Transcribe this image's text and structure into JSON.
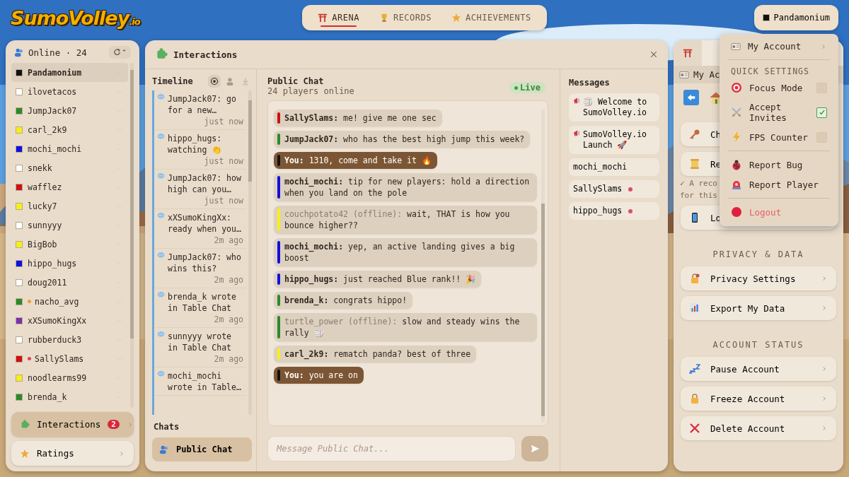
{
  "logo": {
    "name": "SumoVolley",
    "suffix": ".io"
  },
  "nav": [
    {
      "label": "ARENA",
      "selected": true
    },
    {
      "label": "RECORDS",
      "selected": false
    },
    {
      "label": "ACHIEVEMENTS",
      "selected": false
    }
  ],
  "user_button": {
    "label": "Pandamonium",
    "color": "#111111"
  },
  "online": {
    "title": "Online · 24"
  },
  "players": [
    {
      "name": "Pandamonium",
      "color": "#111111",
      "away": false,
      "busy": false,
      "selected": true
    },
    {
      "name": "ilovetacos",
      "color": "#ffffff",
      "away": false,
      "busy": false,
      "selected": false
    },
    {
      "name": "JumpJack07",
      "color": "#2a8a2a",
      "away": false,
      "busy": false,
      "selected": false
    },
    {
      "name": "carl_2k9",
      "color": "#f5f01a",
      "away": false,
      "busy": false,
      "selected": false
    },
    {
      "name": "mochi_mochi",
      "color": "#1010e0",
      "away": false,
      "busy": false,
      "selected": false
    },
    {
      "name": "snekk",
      "color": "#ffffff",
      "away": false,
      "busy": false,
      "selected": false
    },
    {
      "name": "wafflez",
      "color": "#cc1111",
      "away": false,
      "busy": false,
      "selected": false
    },
    {
      "name": "lucky7",
      "color": "#f5f01a",
      "away": false,
      "busy": false,
      "selected": false
    },
    {
      "name": "sunnyyy",
      "color": "#ffffff",
      "away": false,
      "busy": false,
      "selected": false
    },
    {
      "name": "BigBob",
      "color": "#f5f01a",
      "away": false,
      "busy": false,
      "selected": false
    },
    {
      "name": "hippo_hugs",
      "color": "#1010e0",
      "away": false,
      "busy": false,
      "selected": false
    },
    {
      "name": "doug2011",
      "color": "#ffffff",
      "away": false,
      "busy": false,
      "selected": false
    },
    {
      "name": "nacho_avg",
      "color": "#2a8a2a",
      "away": true,
      "busy": false,
      "selected": false
    },
    {
      "name": "xXSumoKingXx",
      "color": "#7a30b0",
      "away": false,
      "busy": false,
      "selected": false
    },
    {
      "name": "rubberduck3",
      "color": "#ffffff",
      "away": false,
      "busy": false,
      "selected": false
    },
    {
      "name": "SallySlams",
      "color": "#cc1111",
      "away": false,
      "busy": true,
      "selected": false
    },
    {
      "name": "noodlearms99",
      "color": "#f5f01a",
      "away": false,
      "busy": false,
      "selected": false
    },
    {
      "name": "brenda_k",
      "color": "#2a8a2a",
      "away": false,
      "busy": false,
      "selected": false
    }
  ],
  "side_buttons": [
    {
      "label": "Interactions",
      "badge": "2",
      "selected": true
    },
    {
      "label": "Ratings",
      "selected": false
    }
  ],
  "interactions": {
    "title": "Interactions",
    "timeline": {
      "title": "Timeline",
      "filters": [
        {
          "selected": true
        },
        {
          "selected": false
        },
        {
          "selected": false
        }
      ],
      "items": [
        {
          "text": "JumpJack07: go for a new…",
          "time": "just now"
        },
        {
          "text": "hippo_hugs: watching 👏",
          "time": "just now"
        },
        {
          "text": "JumpJack07: how high can you…",
          "time": "just now"
        },
        {
          "text": "xXSumoKingXx: ready when you…",
          "time": "2m ago"
        },
        {
          "text": "JumpJack07: who wins this?",
          "time": "2m ago"
        },
        {
          "text": "brenda_k wrote in Table Chat",
          "time": "2m ago"
        },
        {
          "text": "sunnyyy wrote in Table Chat",
          "time": "2m ago"
        },
        {
          "text": "mochi_mochi wrote in Table…"
        }
      ]
    },
    "chats_title": "Chats",
    "chats": [
      {
        "label": "Public Chat",
        "selected": true
      }
    ],
    "chat": {
      "title": "Public Chat",
      "subtitle": "24 players online",
      "live": "Live",
      "messages": [
        {
          "kind": "online",
          "author": "SallySlams:",
          "text": "me! give me one sec",
          "color": "#cc1111"
        },
        {
          "kind": "online",
          "author": "JumpJack07:",
          "text": "who has the best high jump this week?",
          "color": "#2a8a2a"
        },
        {
          "kind": "self",
          "author": "You:",
          "text": "1310, come and take it 🔥",
          "color": "#111111"
        },
        {
          "kind": "online",
          "author": "mochi_mochi:",
          "text": "tip for new players: hold a direction when you land on the pole",
          "color": "#1010e0"
        },
        {
          "kind": "offline",
          "author": "couchpotato42 (offline):",
          "text": "wait, THAT is how you bounce higher??",
          "color": "#f5f01a"
        },
        {
          "kind": "online",
          "author": "mochi_mochi:",
          "text": "yep, an active landing gives a big boost",
          "color": "#1010e0"
        },
        {
          "kind": "online",
          "author": "hippo_hugs:",
          "text": "just reached Blue rank!! 🎉",
          "color": "#1010e0"
        },
        {
          "kind": "online",
          "author": "brenda_k:",
          "text": "congrats hippo!",
          "color": "#2a8a2a"
        },
        {
          "kind": "offline",
          "author": "turtle_power (offline):",
          "text": "slow and steady wins the rally 🏐",
          "color": "#2a8a2a"
        },
        {
          "kind": "online",
          "author": "carl_2k9:",
          "text": "rematch panda? best of three",
          "color": "#f5f01a"
        },
        {
          "kind": "self",
          "author": "You:",
          "text": "you are on",
          "color": "#111111"
        }
      ],
      "placeholder": "Message Public Chat..."
    },
    "messages": {
      "title": "Messages",
      "items": [
        {
          "kind": "announcement",
          "label": "🏐 Welcome to SumoVolley.io",
          "unread": false
        },
        {
          "kind": "announcement",
          "label": "SumoVolley.io Launch 🚀",
          "unread": false
        },
        {
          "kind": "direct",
          "label": "mochi_mochi",
          "unread": false
        },
        {
          "kind": "direct",
          "label": "SallySlams",
          "unread": true
        },
        {
          "kind": "direct",
          "label": "hippo_hugs",
          "unread": true
        }
      ]
    }
  },
  "account_panel": {
    "tabs": [
      {
        "selected": true
      }
    ],
    "header": "My Ac",
    "partial_rows": [
      "Ch",
      "Re"
    ],
    "note": "✓ A reco for this",
    "partial_rows_2": [
      "Lo"
    ],
    "sections": [
      {
        "title": "PRIVACY & DATA",
        "rows": [
          "Privacy Settings",
          "Export My Data"
        ]
      },
      {
        "title": "ACCOUNT STATUS",
        "rows": [
          "Pause Account",
          "Freeze Account",
          "Delete Account"
        ]
      }
    ]
  },
  "dropdown": {
    "title": "My Account",
    "section": "QUICK SETTINGS",
    "toggles": [
      {
        "label": "Focus Mode",
        "checked": false
      },
      {
        "label": "Accept Invites",
        "checked": true
      },
      {
        "label": "FPS Counter",
        "checked": false
      }
    ],
    "actions": [
      {
        "label": "Report Bug",
        "kind": "normal"
      },
      {
        "label": "Report Player",
        "kind": "normal"
      },
      {
        "label": "Logout",
        "kind": "danger"
      }
    ]
  }
}
